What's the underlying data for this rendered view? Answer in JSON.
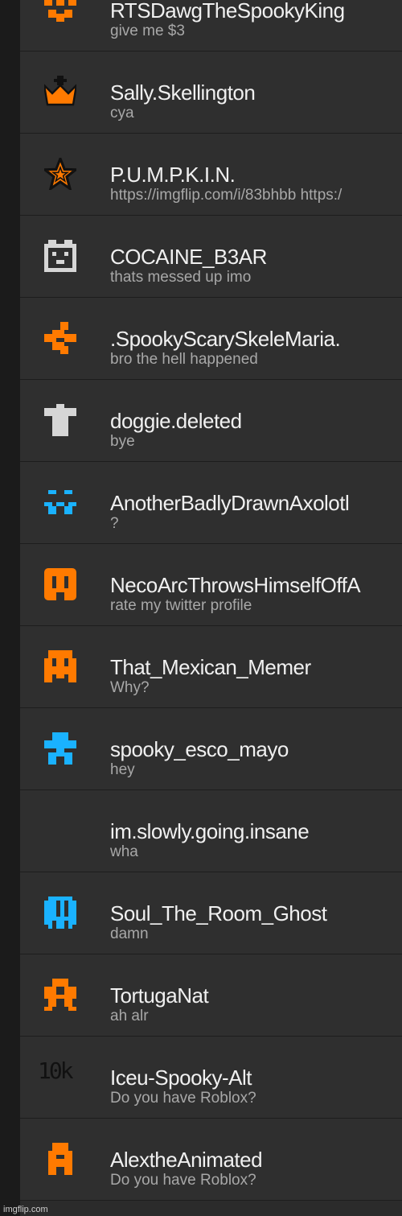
{
  "colors": {
    "orange": "#ff7a00",
    "cyan": "#1ab2ff",
    "gray": "#d6d6d6",
    "black": "#111111"
  },
  "users": [
    {
      "name": "RTSDawgTheSpookyKing",
      "message": "give me $3",
      "icon": "orange-pixel-creature-icon"
    },
    {
      "name": "Sally.Skellington",
      "message": "cya",
      "icon": "orange-crown-icon"
    },
    {
      "name": "P.U.M.P.K.I.N.",
      "message": "https://imgflip.com/i/83bhbb https:/",
      "icon": "orange-star-icon"
    },
    {
      "name": "COCAINE_B3AR",
      "message": "thats messed up imo",
      "icon": "gray-pixel-face-icon"
    },
    {
      "name": ".SpookyScarySkeleMaria.",
      "message": "bro the hell happened",
      "icon": "orange-pixel-creature-icon"
    },
    {
      "name": "doggie.deleted",
      "message": "bye",
      "icon": "gray-shirt-icon"
    },
    {
      "name": "AnotherBadlyDrawnAxolotl",
      "message": "?",
      "icon": "cyan-pixel-face-icon"
    },
    {
      "name": "NecoArcThrowsHimselfOffA",
      "message": "rate my twitter profile",
      "icon": "orange-pixel-face-icon"
    },
    {
      "name": "That_Mexican_Memer",
      "message": "Why?",
      "icon": "orange-pixel-ghost-icon"
    },
    {
      "name": "spooky_esco_mayo",
      "message": "hey",
      "icon": "cyan-pixel-alien-icon"
    },
    {
      "name": "im.slowly.going.insane",
      "message": "wha",
      "icon": ""
    },
    {
      "name": "Soul_The_Room_Ghost",
      "message": "damn",
      "icon": "cyan-pixel-ghost-icon"
    },
    {
      "name": "TortugaNat",
      "message": "ah alr",
      "icon": "orange-pixel-turtle-icon"
    },
    {
      "name": "Iceu-Spooky-Alt",
      "message": "Do you have Roblox?",
      "icon": "10k-text-icon",
      "icon_text": "10k"
    },
    {
      "name": "AlextheAnimated",
      "message": "Do you have Roblox?",
      "icon": "orange-pixel-letter-a-icon"
    }
  ],
  "watermark": "imgflip.com"
}
